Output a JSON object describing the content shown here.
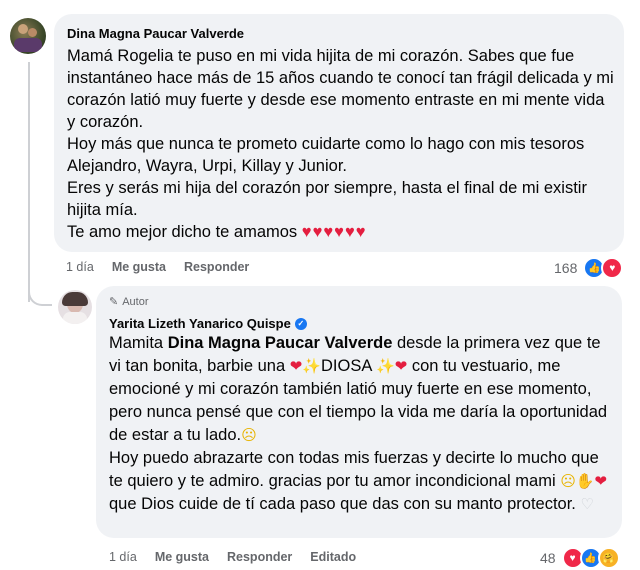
{
  "comment1": {
    "author": "Dina Magna Paucar Valverde",
    "paragraphs": [
      "Mamá Rogelia te puso en mi vida hijita de mi corazón. Sabes que fue instantáneo hace más de 15 años cuando te conocí tan frágil delicada y mi corazón latió muy fuerte y desde ese momento entraste en mi mente vida y corazón.",
      "Hoy más que nunca te prometo cuidarte como lo hago con mis tesoros Alejandro, Wayra, Urpi, Killay y Junior.",
      "Eres y serás mi hija del corazón por siempre, hasta el final de mi existir hijita mía.",
      "Te amo mejor dicho te amamos"
    ],
    "hearts": "♥♥♥♥♥♥",
    "time": "1 día",
    "like_label": "Me gusta",
    "reply_label": "Responder",
    "reaction_count": "168",
    "reaction_icons": [
      "like",
      "love"
    ],
    "colors": {
      "like": "#1877f2",
      "love": "#f02849"
    }
  },
  "comment2": {
    "badge": "Autor",
    "author": "Yarita Lizeth Yanarico Quispe",
    "verified": true,
    "line1_prefix": "Mamita ",
    "line1_mention": "Dina Magna Paucar Valverde",
    "line1_rest": " desde la primera vez que te vi tan bonita, barbie una ",
    "line1_word": "DIOSA",
    "line1_end": " con tu vestuario, me emocioné y mi corazón también latió muy fuerte en ese momento, pero nunca pensé que con el tiempo la vida me daría la oportunidad de estar a tu lado.",
    "line2": "Hoy puedo abrazarte con todas mis fuerzas y decirte lo mucho que te quiero y te admiro. gracias por tu amor incondicional mami",
    "line2_end": " que Dios cuide de tí cada paso que das con su manto protector.",
    "time": "1 día",
    "like_label": "Me gusta",
    "reply_label": "Responder",
    "edited_label": "Editado",
    "reaction_count": "48",
    "reaction_icons": [
      "love",
      "like",
      "care"
    ]
  }
}
